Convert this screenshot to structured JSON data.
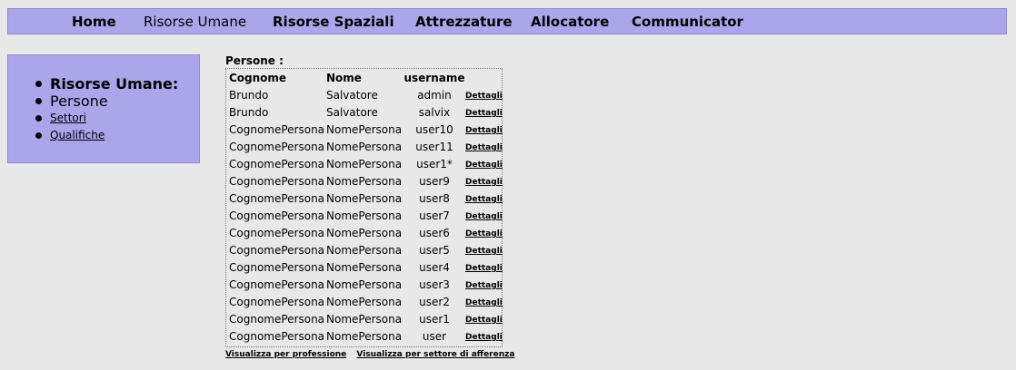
{
  "topnav": {
    "items": [
      {
        "label": "Home"
      },
      {
        "label": "Risorse Umane"
      },
      {
        "label": "Risorse Spaziali"
      },
      {
        "label": "Attrezzature"
      },
      {
        "label": "Allocatore"
      },
      {
        "label": "Communicator"
      }
    ]
  },
  "sidebar": {
    "heading": "Risorse Umane:",
    "current": "Persone",
    "links": [
      "Settori",
      "Qualifiche"
    ]
  },
  "section": {
    "title": "Persone :"
  },
  "table": {
    "columns": [
      "Cognome",
      "Nome",
      "username"
    ],
    "detail_label": "Dettagli",
    "rows": [
      {
        "cognome": "Brundo",
        "nome": "Salvatore",
        "username": "admin"
      },
      {
        "cognome": "Brundo",
        "nome": "Salvatore",
        "username": "salvix"
      },
      {
        "cognome": "CognomePersona",
        "nome": "NomePersona",
        "username": "user10"
      },
      {
        "cognome": "CognomePersona",
        "nome": "NomePersona",
        "username": "user11"
      },
      {
        "cognome": "CognomePersona",
        "nome": "NomePersona",
        "username": "user1*"
      },
      {
        "cognome": "CognomePersona",
        "nome": "NomePersona",
        "username": "user9"
      },
      {
        "cognome": "CognomePersona",
        "nome": "NomePersona",
        "username": "user8"
      },
      {
        "cognome": "CognomePersona",
        "nome": "NomePersona",
        "username": "user7"
      },
      {
        "cognome": "CognomePersona",
        "nome": "NomePersona",
        "username": "user6"
      },
      {
        "cognome": "CognomePersona",
        "nome": "NomePersona",
        "username": "user5"
      },
      {
        "cognome": "CognomePersona",
        "nome": "NomePersona",
        "username": "user4"
      },
      {
        "cognome": "CognomePersona",
        "nome": "NomePersona",
        "username": "user3"
      },
      {
        "cognome": "CognomePersona",
        "nome": "NomePersona",
        "username": "user2"
      },
      {
        "cognome": "CognomePersona",
        "nome": "NomePersona",
        "username": "user1"
      },
      {
        "cognome": "CognomePersona",
        "nome": "NomePersona",
        "username": "user"
      }
    ]
  },
  "footer": {
    "links": [
      "Visualizza per professione",
      "Visualizza per settore di afferenza"
    ]
  }
}
